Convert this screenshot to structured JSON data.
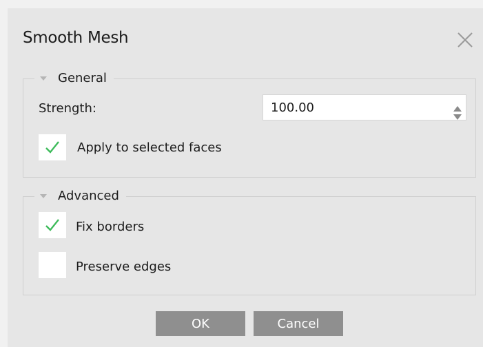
{
  "dialog": {
    "title": "Smooth Mesh",
    "close_icon": "close-icon"
  },
  "general": {
    "title": "General",
    "strength_label": "Strength:",
    "strength_value": "100.00",
    "apply_selected": {
      "label": "Apply to selected faces",
      "checked": true
    }
  },
  "advanced": {
    "title": "Advanced",
    "fix_borders": {
      "label": "Fix borders",
      "checked": true
    },
    "preserve_edges": {
      "label": "Preserve edges",
      "checked": false
    }
  },
  "buttons": {
    "ok": "OK",
    "cancel": "Cancel"
  },
  "colors": {
    "check": "#3dbb5a",
    "button": "#8f8f8f",
    "dialog_bg": "#e6e6e6"
  }
}
